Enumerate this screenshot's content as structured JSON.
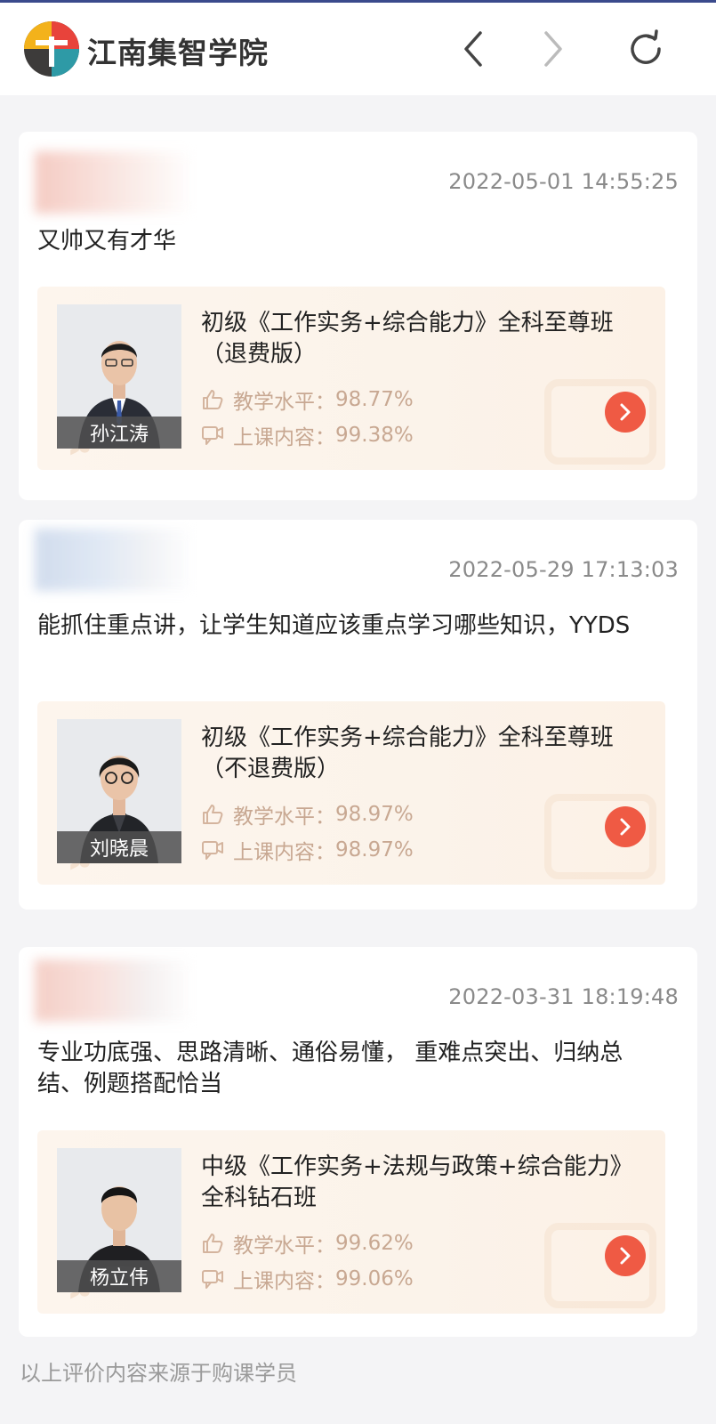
{
  "header": {
    "brand": "江南集智学院",
    "back_icon": "chevron-left-icon",
    "forward_icon": "chevron-right-icon",
    "refresh_icon": "refresh-icon"
  },
  "colors": {
    "accent": "#ef5a44",
    "stat_text": "#c8a892",
    "course_bg": "#fbf3ea"
  },
  "reviews": [
    {
      "timestamp": "2022-05-01 14:55:25",
      "comment": "又帅又有才华",
      "course": {
        "title": "初级《工作实务+综合能力》全科至尊班（退费版）",
        "teacher": "孙江涛",
        "teaching_label": "教学水平：",
        "teaching_value": "98.77%",
        "content_label": "上课内容：",
        "content_value": "99.38%"
      }
    },
    {
      "timestamp": "2022-05-29 17:13:03",
      "comment": "能抓住重点讲，让学生知道应该重点学习哪些知识，YYDS",
      "course": {
        "title": "初级《工作实务+综合能力》全科至尊班（不退费版）",
        "teacher": "刘晓晨",
        "teaching_label": "教学水平：",
        "teaching_value": "98.97%",
        "content_label": "上课内容：",
        "content_value": "98.97%"
      }
    },
    {
      "timestamp": "2022-03-31 18:19:48",
      "comment": "专业功底强、思路清晰、通俗易懂， 重难点突出、归纳总结、例题搭配恰当",
      "course": {
        "title": "中级《工作实务+法规与政策+综合能力》全科钻石班",
        "teacher": "杨立伟",
        "teaching_label": "教学水平：",
        "teaching_value": "99.62%",
        "content_label": "上课内容：",
        "content_value": "99.06%"
      }
    }
  ],
  "footer": {
    "note": "以上评价内容来源于购课学员"
  }
}
